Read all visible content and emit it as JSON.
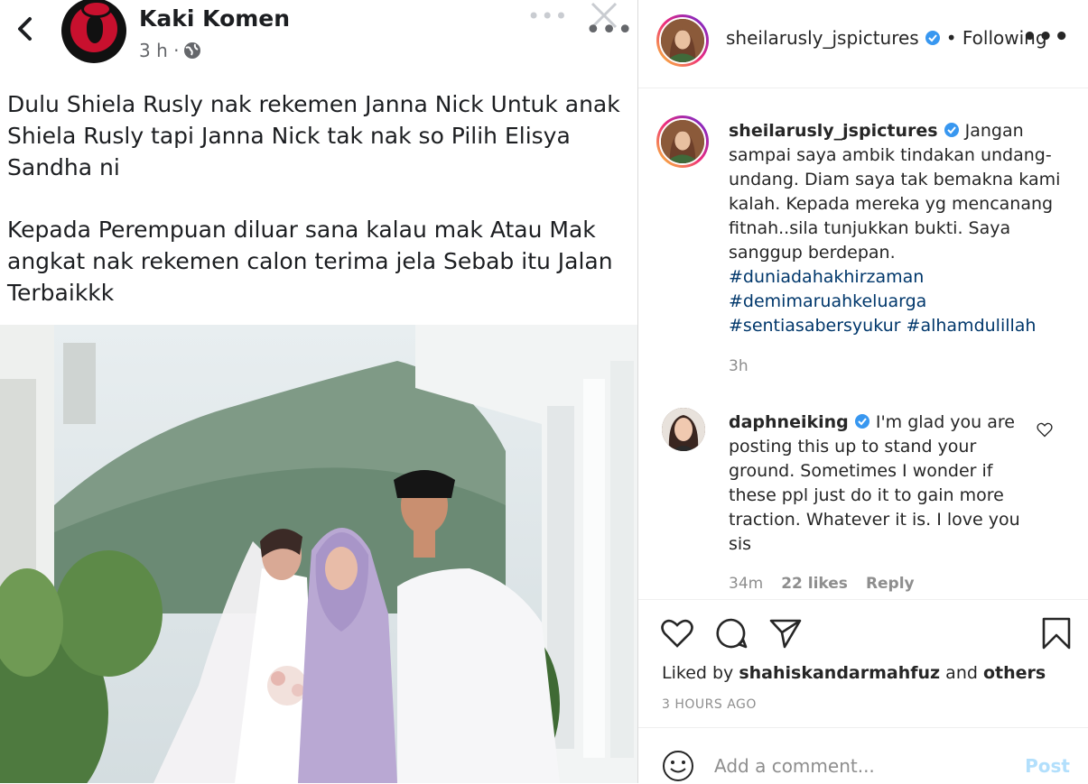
{
  "facebook_post": {
    "page_name": "Kaki Komen",
    "time": "3 h ·",
    "paragraphs": [
      "Dulu Shiela Rusly nak rekemen Janna Nick Untuk anak Shiela Rusly tapi Janna Nick tak nak so Pilih Elisya Sandha ni",
      "Kepada Perempuan diluar sana kalau mak Atau Mak angkat nak rekemen calon terima jela Sebab itu Jalan Terbaikkk"
    ]
  },
  "instagram": {
    "header": {
      "username": "sheilarusly_jspictures",
      "following": "• Following",
      "more": "•••"
    },
    "caption": {
      "username": "sheilarusly_jspictures",
      "text": "Jangan sampai saya ambik tindakan undang-undang. Diam saya tak bemakna kami kalah. Kepada mereka yg mencanang fitnah..sila tunjukkan bukti. Saya sanggup berdepan.",
      "hashtags": [
        "#duniadahakhirzaman",
        "#demimaruahkeluarga",
        "#sentiasabersyukur",
        "#alhamdulillah"
      ],
      "time": "3h"
    },
    "comment": {
      "username": "daphneiking",
      "text": "I'm glad you are posting this up to stand your ground. Sometimes I wonder if these ppl just do it to gain more traction. Whatever it is. I love you sis",
      "time": "34m",
      "likes": "22 likes",
      "reply": "Reply"
    },
    "likes": {
      "prefix": "Liked by",
      "user": "shahiskandarmahfuz",
      "and": "and",
      "others": "others"
    },
    "posted_ago": "3 HOURS AGO",
    "add_comment_placeholder": "Add a comment...",
    "post_label": "Post"
  }
}
